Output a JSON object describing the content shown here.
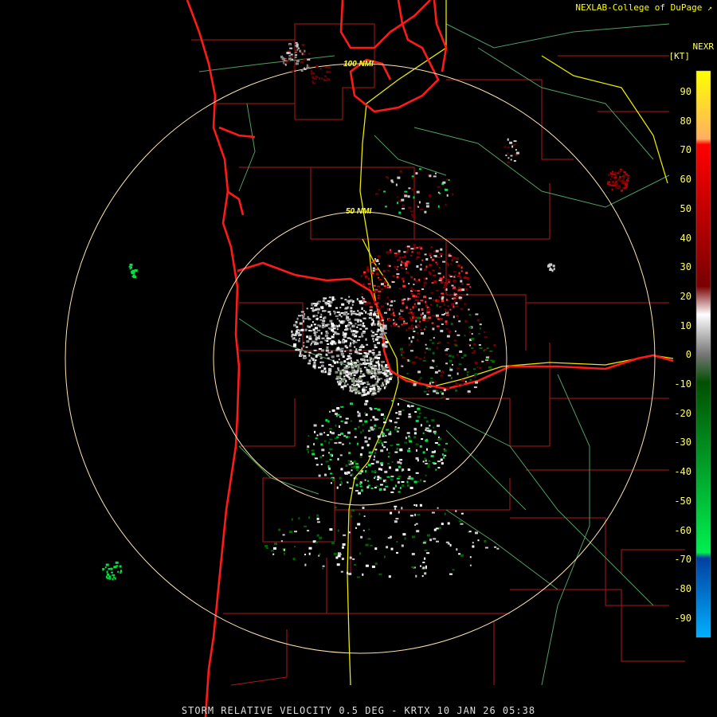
{
  "header": {
    "credit": "NEXLAB-College of DuPage",
    "credit_icon": "external-link-icon"
  },
  "legend": {
    "product": "NEXR",
    "unit": "[KT]",
    "ticks": [
      "90",
      "80",
      "70",
      "60",
      "50",
      "40",
      "30",
      "20",
      "10",
      "0",
      "-10",
      "-20",
      "-30",
      "-40",
      "-50",
      "-60",
      "-70",
      "-80",
      "-90"
    ],
    "colors": {
      "top": "#ffff00",
      "orange": "#ffb060",
      "red": "#ff0000",
      "darkred": "#6a0000",
      "gray": "#cccccc",
      "darkgreen": "#006400",
      "green": "#00e040",
      "darkblue": "#0040a0",
      "blue": "#00aaff"
    }
  },
  "rings": {
    "inner": "50 NMI",
    "outer": "100 NMI"
  },
  "caption": "STORM RELATIVE VELOCITY 0.5 DEG - KRTX 10 JAN 26 05:38"
}
